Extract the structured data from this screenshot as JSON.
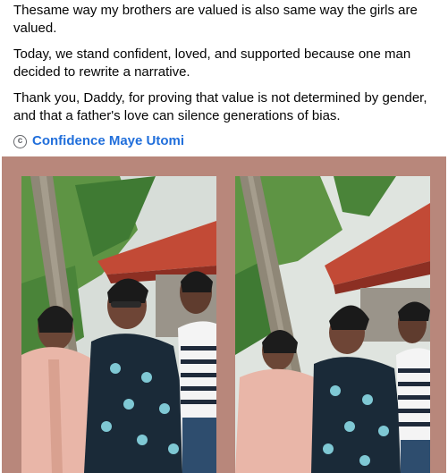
{
  "post": {
    "paragraphs": [
      "Thesame way my brothers are valued is also same way the girls are valued.",
      "Today, we stand confident, loved, and supported because one man decided to rewrite a narrative.",
      "Thank you, Daddy, for proving that value is not determined by gender, and that a father's love can silence generations of bias."
    ],
    "author_icon": "copyright-icon",
    "author_name": "Confidence Maye Utomi"
  },
  "photos": {
    "count": 2,
    "frame_color": "#b8877b",
    "accent_colors": {
      "roof": "#c24a36",
      "dress": "#1a2a38",
      "pink_outfit": "#e9b6a8",
      "palm": "#4f8a3a"
    }
  }
}
